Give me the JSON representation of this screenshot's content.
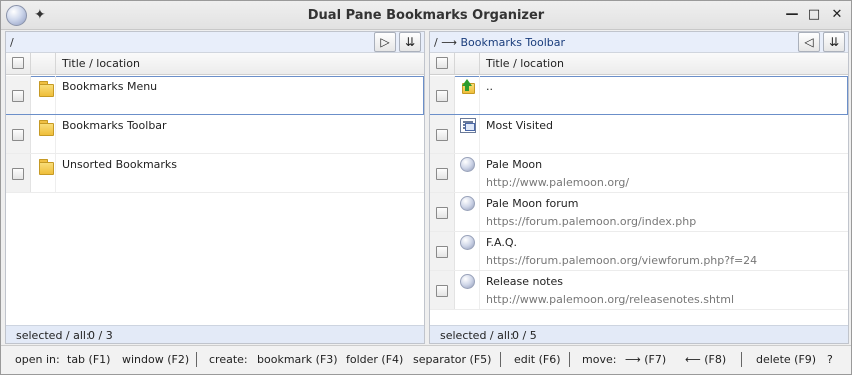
{
  "window": {
    "title": "Dual Pane Bookmarks Organizer",
    "controls": {
      "minimize": "—",
      "maximize": "□",
      "close": "✕"
    }
  },
  "left_pane": {
    "path": "/",
    "path_buttons": [
      "▷",
      "⇊"
    ],
    "column_title": "Title / location",
    "rows": [
      {
        "type": "folder",
        "title": "Bookmarks Menu",
        "url": "",
        "selected": true
      },
      {
        "type": "folder",
        "title": "Bookmarks Toolbar",
        "url": ""
      },
      {
        "type": "folder",
        "title": "Unsorted Bookmarks",
        "url": ""
      }
    ],
    "status_label": "selected / all:",
    "status_value": "0 / 3"
  },
  "right_pane": {
    "path_prefix": "/ ⟶",
    "path_crumb": "Bookmarks Toolbar",
    "path_buttons": [
      "◁",
      "⇊"
    ],
    "column_title": "Title / location",
    "rows": [
      {
        "type": "up",
        "title": "..",
        "url": "",
        "selected": true
      },
      {
        "type": "most-visited",
        "title": "Most Visited",
        "url": ""
      },
      {
        "type": "bookmark",
        "title": "Pale Moon",
        "url": "http://www.palemoon.org/"
      },
      {
        "type": "bookmark",
        "title": "Pale Moon forum",
        "url": "https://forum.palemoon.org/index.php"
      },
      {
        "type": "bookmark",
        "title": "F.A.Q.",
        "url": "https://forum.palemoon.org/viewforum.php?f=24"
      },
      {
        "type": "bookmark",
        "title": "Release notes",
        "url": "http://www.palemoon.org/releasenotes.shtml"
      }
    ],
    "status_label": "selected / all:",
    "status_value": "0 / 5"
  },
  "toolbar": {
    "open_in": "open in:",
    "tab": "tab (F1)",
    "window": "window (F2)",
    "create": "create:",
    "bookmark": "bookmark (F3)",
    "folder": "folder (F4)",
    "separator": "separator (F5)",
    "edit": "edit (F6)",
    "move": "move:",
    "move_right": "⟶ (F7)",
    "move_left": "⟵ (F8)",
    "delete": "delete (F9)",
    "help": "?"
  }
}
